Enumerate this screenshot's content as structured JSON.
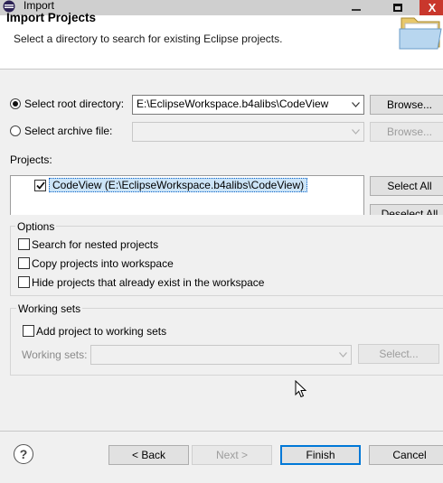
{
  "window": {
    "title": "Import",
    "minimize_glyph": "—",
    "close_glyph": "X"
  },
  "header": {
    "title": "Import Projects",
    "description": "Select a directory to search for existing Eclipse projects."
  },
  "source": {
    "root_radio_label": "Select root directory:",
    "root_value": "E:\\EclipseWorkspace.b4alibs\\CodeView",
    "root_browse_label": "Browse...",
    "archive_radio_label": "Select archive file:",
    "archive_value": "",
    "archive_browse_label": "Browse...",
    "selected": "root"
  },
  "projects": {
    "label": "Projects:",
    "items": [
      {
        "label": "CodeView (E:\\EclipseWorkspace.b4alibs\\CodeView)",
        "checked": true
      }
    ],
    "select_all_label": "Select All",
    "deselect_all_label": "Deselect All"
  },
  "options": {
    "title": "Options",
    "search_nested": "Search for nested projects",
    "copy_into_workspace": "Copy projects into workspace",
    "hide_existing": "Hide projects that already exist in the workspace"
  },
  "working_sets": {
    "title": "Working sets",
    "add_label": "Add project to working sets",
    "sets_label": "Working sets:",
    "sets_value": "",
    "select_label": "Select..."
  },
  "footer": {
    "help_glyph": "?",
    "back_label": "< Back",
    "next_label": "Next >",
    "finish_label": "Finish",
    "cancel_label": "Cancel"
  },
  "colors": {
    "close_button": "#c9372c",
    "primary_border": "#0078d7",
    "selection_bg": "#cce4f7"
  }
}
